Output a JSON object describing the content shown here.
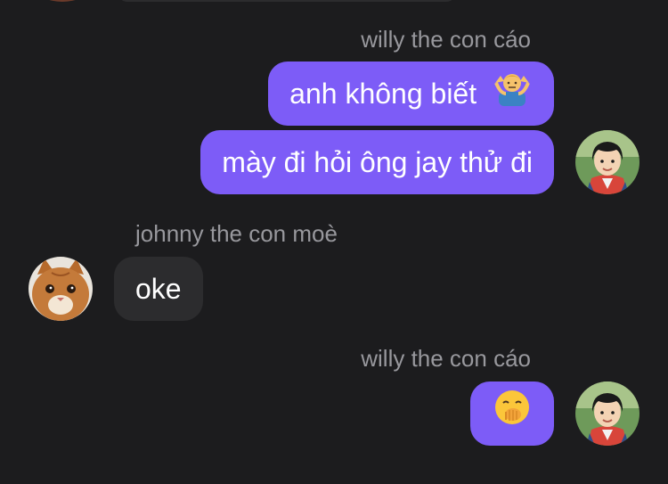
{
  "chat": {
    "messages": [
      {
        "sender": "willy the con cáo",
        "bubbles": [
          {
            "text": "anh không biết",
            "emoji": "person-shrugging-icon"
          },
          {
            "text": "mày đi hỏi ông jay thử đi"
          }
        ]
      },
      {
        "sender": "johnny the con moè",
        "bubbles": [
          {
            "text": "oke"
          }
        ]
      },
      {
        "sender": "willy the con cáo",
        "bubbles": [
          {
            "text": "",
            "emoji": "face-with-hand-over-mouth-icon"
          }
        ]
      }
    ]
  },
  "colors": {
    "background": "#1c1c1e",
    "outgoing_bubble": "#7d5cf7",
    "incoming_bubble": "#2c2c2e",
    "sender_name": "#98989d",
    "text": "#ffffff"
  }
}
